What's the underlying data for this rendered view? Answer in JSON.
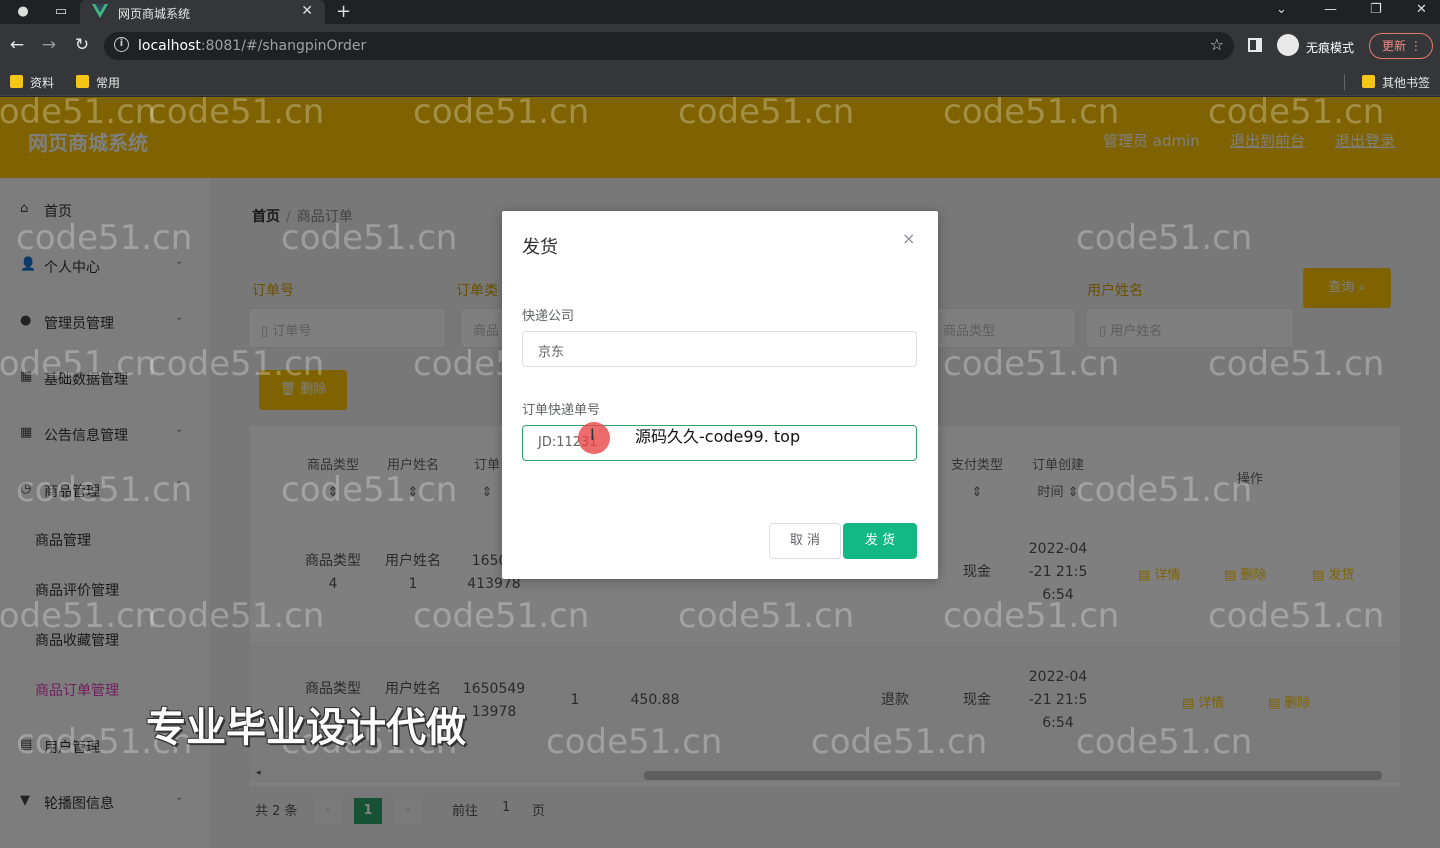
{
  "browser": {
    "tab_title": "网页商城系统",
    "url_host": "localhost",
    "url_path": ":8081/#/shangpinOrder",
    "incognito_label": "无痕模式",
    "update_label": "更新",
    "bookmarks": [
      "资料",
      "常用"
    ],
    "other_bookmarks": "其他书签"
  },
  "header": {
    "brand": "网页商城系统",
    "user": "管理员 admin",
    "to_front": "退出到前台",
    "logout": "退出登录"
  },
  "sidebar": {
    "items": [
      {
        "label": "首页",
        "icon": "home-icon"
      },
      {
        "label": "个人中心",
        "icon": "user-icon"
      },
      {
        "label": "管理员管理",
        "icon": "bulb-icon"
      },
      {
        "label": "基础数据管理",
        "icon": "grid-icon"
      },
      {
        "label": "公告信息管理",
        "icon": "grid-icon"
      },
      {
        "label": "商品管理",
        "icon": "clock-icon"
      }
    ],
    "subitems": [
      "商品管理",
      "商品评价管理",
      "商品收藏管理",
      "商品订单管理"
    ],
    "items2": [
      {
        "label": "用户管理",
        "icon": "doc-icon"
      },
      {
        "label": "轮播图信息",
        "icon": "pin-icon"
      }
    ]
  },
  "breadcrumb": {
    "home": "首页",
    "current": "商品订单"
  },
  "search": {
    "label_order_no": "订单号",
    "label_order_status": "订单类",
    "label_user_name": "用户姓名",
    "placeholder_order_no": "订单号",
    "placeholder_order_status": "商品",
    "placeholder_goods_type": "商品类型",
    "placeholder_user_name": "用户姓名",
    "query_button": "查询"
  },
  "delete_button": "删除",
  "table": {
    "headers": {
      "goods_type": "商品类型",
      "user_name": "用户姓名",
      "order_no": "订单",
      "pay_type": "支付类型",
      "create_time_1": "订单创建",
      "create_time_2": "时间",
      "ops": "操作"
    },
    "rows": [
      {
        "goods_type_1": "商品类型",
        "goods_type_2": "4",
        "user_name_1": "用户姓名",
        "user_name_2": "1",
        "order_no_1": "16505",
        "order_no_2": "413978",
        "pay": "现金",
        "time_1": "2022-04",
        "time_2": "-21 21:5",
        "time_3": "6:54",
        "ops": [
          "详情",
          "删除",
          "发货"
        ]
      },
      {
        "goods_type_1": "商品类型",
        "goods_type_2": "",
        "user_name_1": "用户姓名",
        "user_name_2": "",
        "order_no_1": "1650549",
        "order_no_2": "13978",
        "qty": "1",
        "price": "450.88",
        "status": "退款",
        "pay": "现金",
        "time_1": "2022-04",
        "time_2": "-21 21:5",
        "time_3": "6:54",
        "ops": [
          "详情",
          "删除"
        ]
      }
    ]
  },
  "pager": {
    "total": "共 2 条",
    "current": "1",
    "goto": "前往",
    "page_value": "1",
    "page_suffix": "页",
    "prev": "‹",
    "next": "›"
  },
  "dialog": {
    "title": "发货",
    "close": "×",
    "label_company": "快递公司",
    "company_value": "京东",
    "label_tracking": "订单快递单号",
    "tracking_value": "JD:11231",
    "cancel": "取 消",
    "confirm": "发 货"
  },
  "overlay": {
    "source_text": "源码久久-code99. top",
    "promo": "专业毕业设计代做",
    "watermark": "code51.cn"
  }
}
